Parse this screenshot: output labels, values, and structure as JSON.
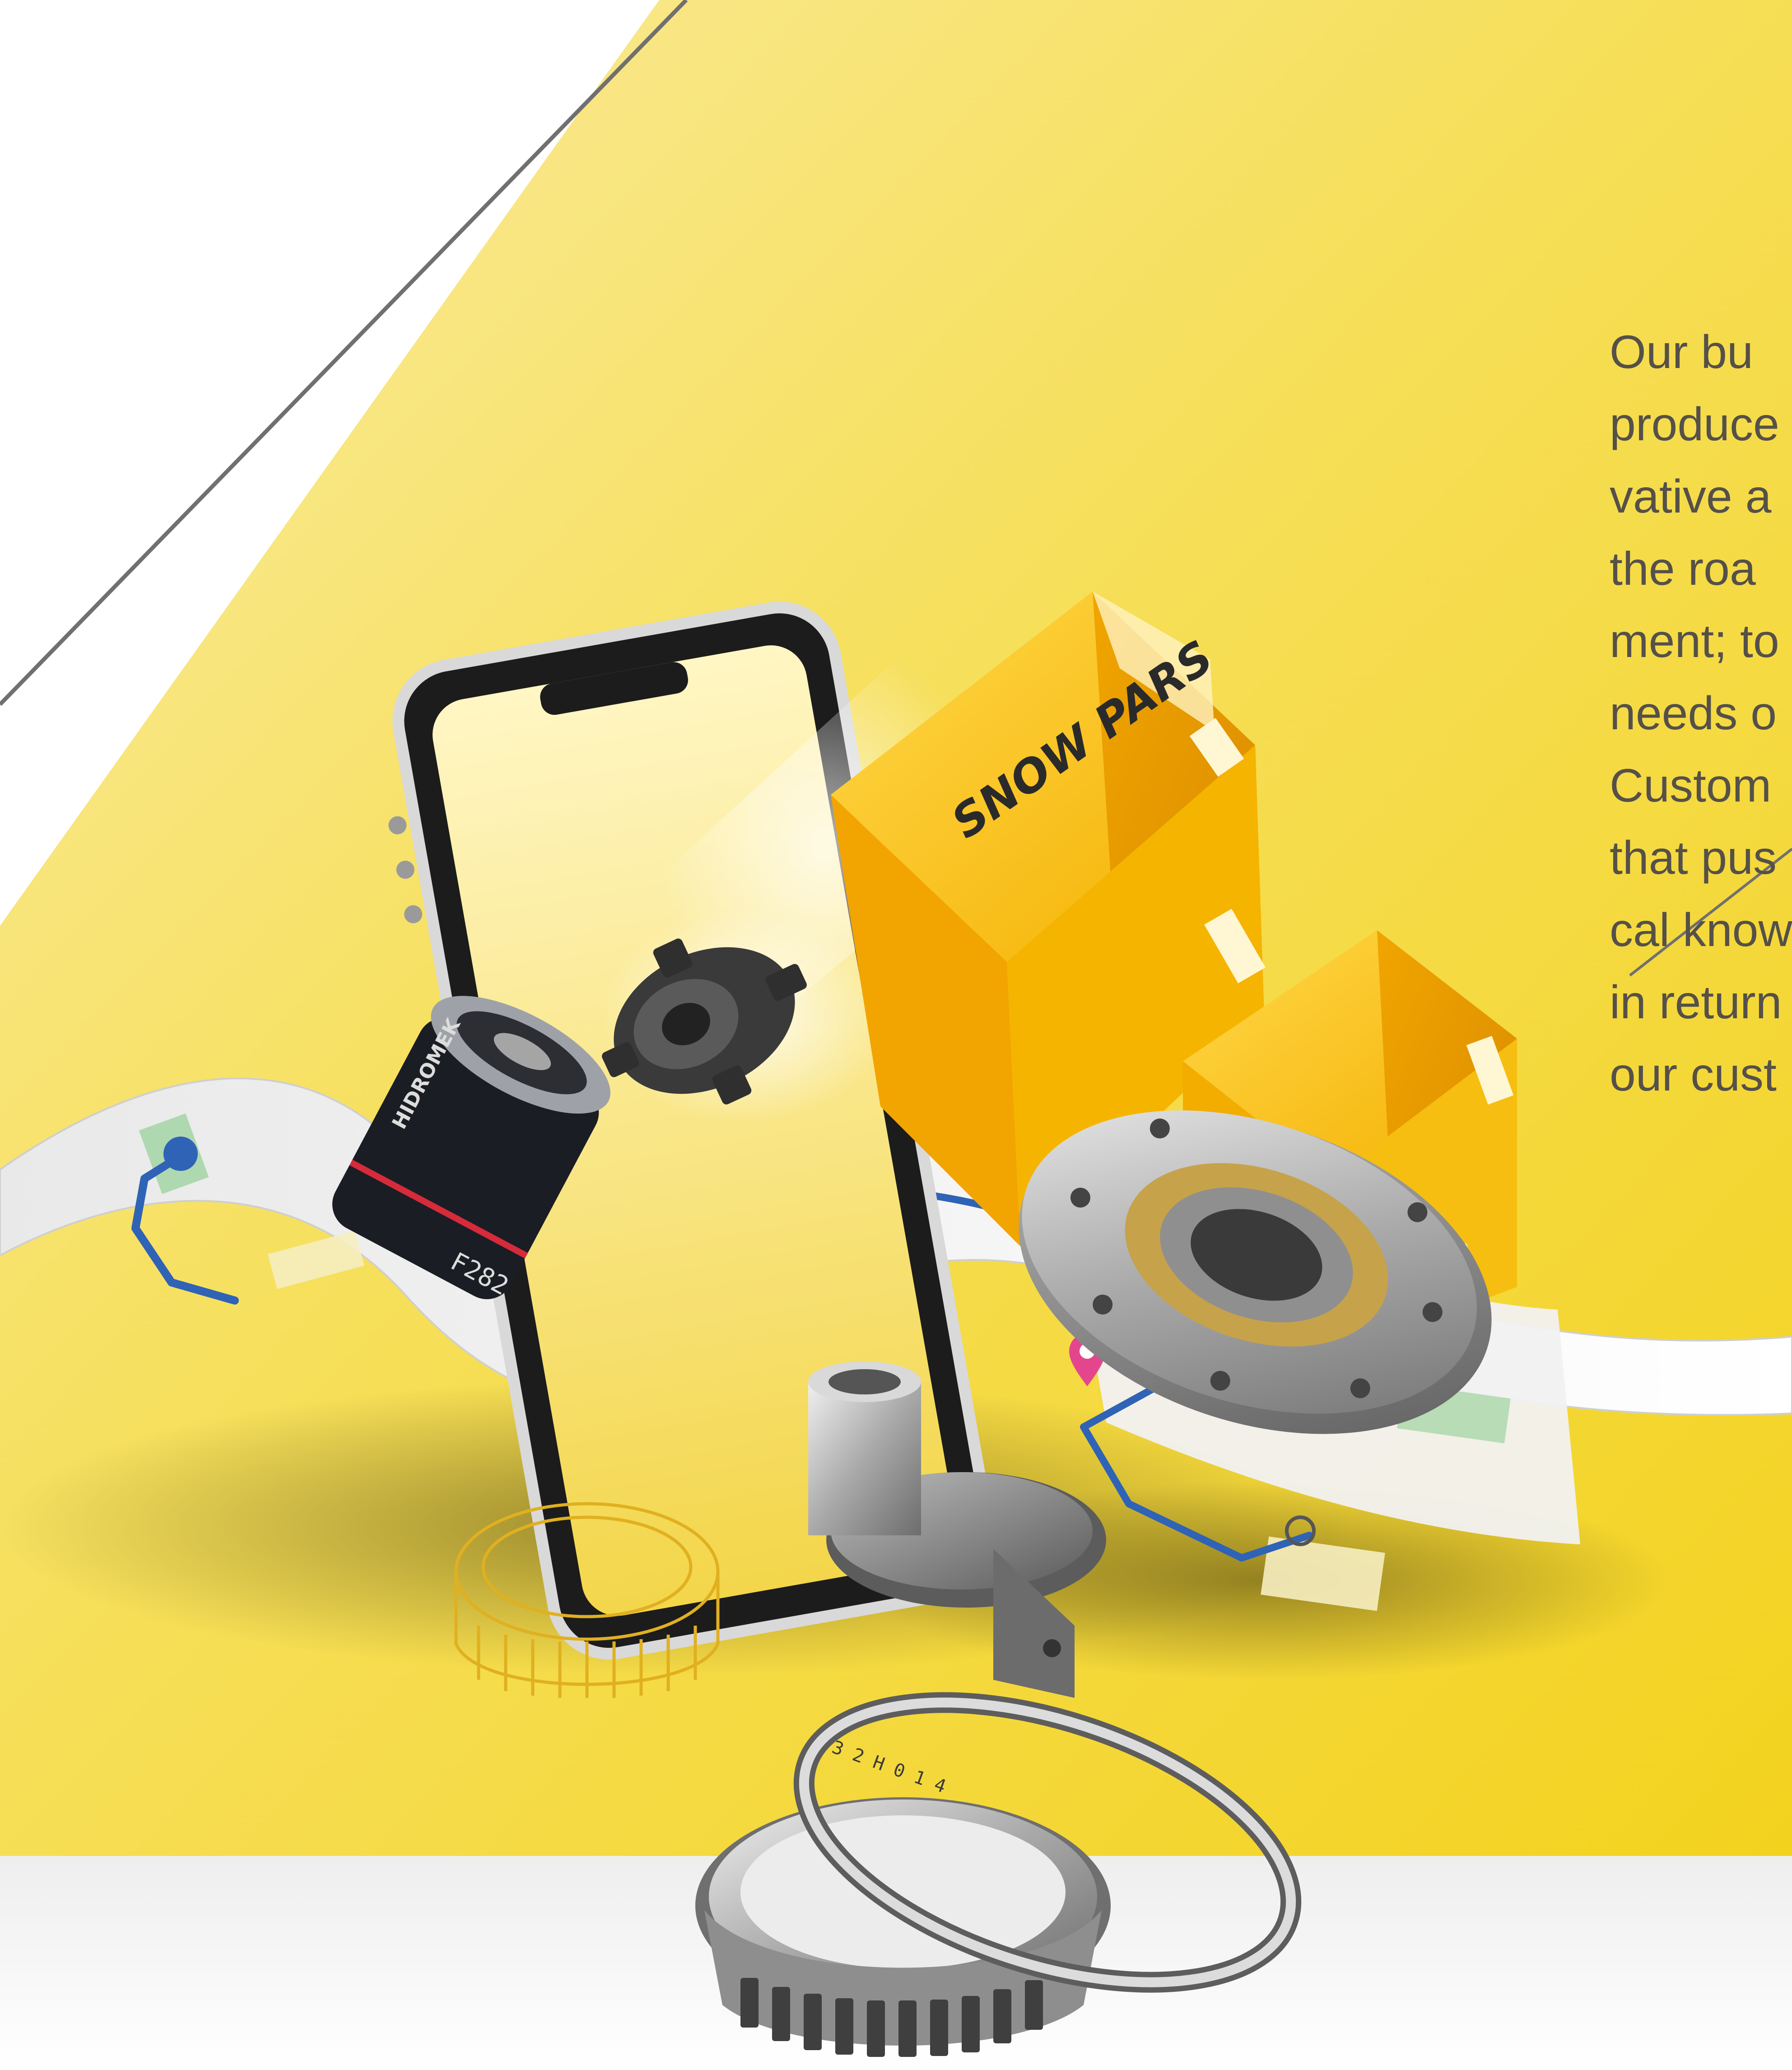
{
  "palette": {
    "background": "#ffffff",
    "yellow_light": "#f7e68a",
    "yellow_main": "#f6d935",
    "yellow_deep": "#f2c200",
    "box_orange": "#f0a800",
    "text_gray": "#555049",
    "route_blue": "#2f63b6",
    "pin_pink": "#e4468e"
  },
  "box": {
    "label": "SNOW PARS"
  },
  "filter": {
    "brand_label": "HIDROMEK",
    "part_code": "F282"
  },
  "bearing_markings": {
    "inner_ring": "3 2 H 0 1 4"
  },
  "body_text": {
    "lines": [
      "Our bu",
      "produce",
      "vative a",
      "the roa",
      "ment; to",
      "needs o",
      "Custom",
      "that pus",
      "cal know",
      "in return",
      "our cust"
    ]
  },
  "icons": {
    "map_pin": "map-pin-icon",
    "route_start": "route-start-icon"
  }
}
